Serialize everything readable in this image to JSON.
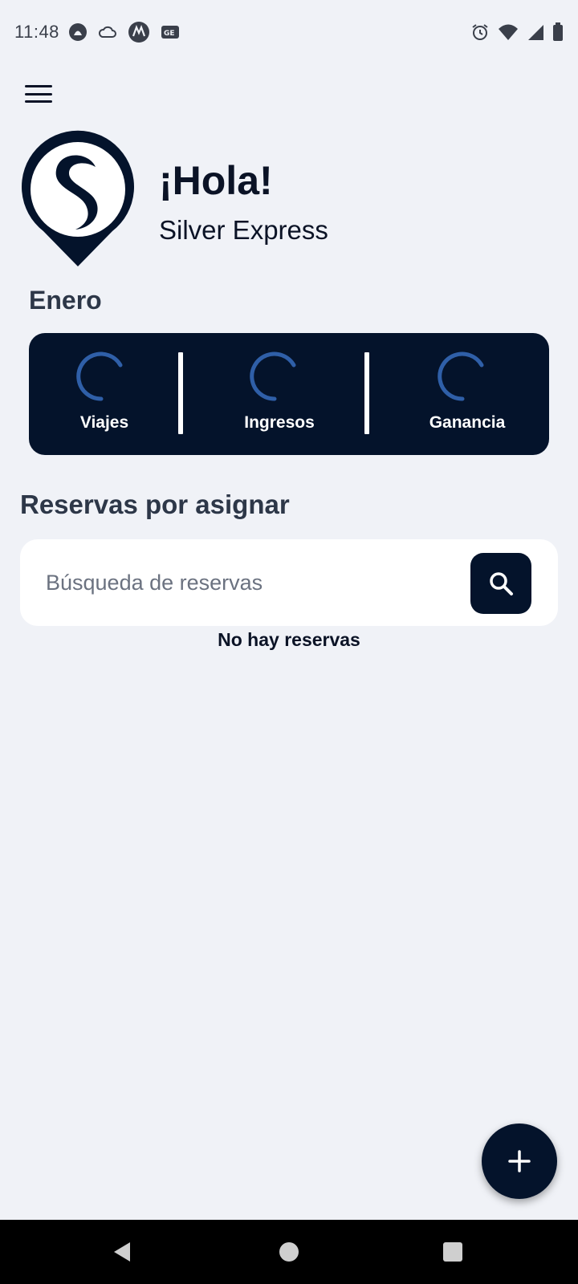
{
  "status_bar": {
    "time": "11:48",
    "left_icons": [
      "santander-icon",
      "cloud-icon",
      "motorola-icon",
      "ge-icon"
    ],
    "right_icons": [
      "alarm-icon",
      "wifi-icon",
      "signal-icon",
      "battery-icon"
    ]
  },
  "header": {
    "greeting": "¡Hola!",
    "company_name": "Silver Express"
  },
  "stats": {
    "month": "Enero",
    "items": [
      {
        "label": "Viajes"
      },
      {
        "label": "Ingresos"
      },
      {
        "label": "Ganancia"
      }
    ]
  },
  "reservations": {
    "title": "Reservas por asignar",
    "search_placeholder": "Búsqueda de reservas",
    "search_value": "",
    "empty_message": "No hay reservas"
  },
  "colors": {
    "background": "#f0f2f7",
    "primary_dark": "#04132b",
    "spinner_blue": "#2f5fa8"
  }
}
